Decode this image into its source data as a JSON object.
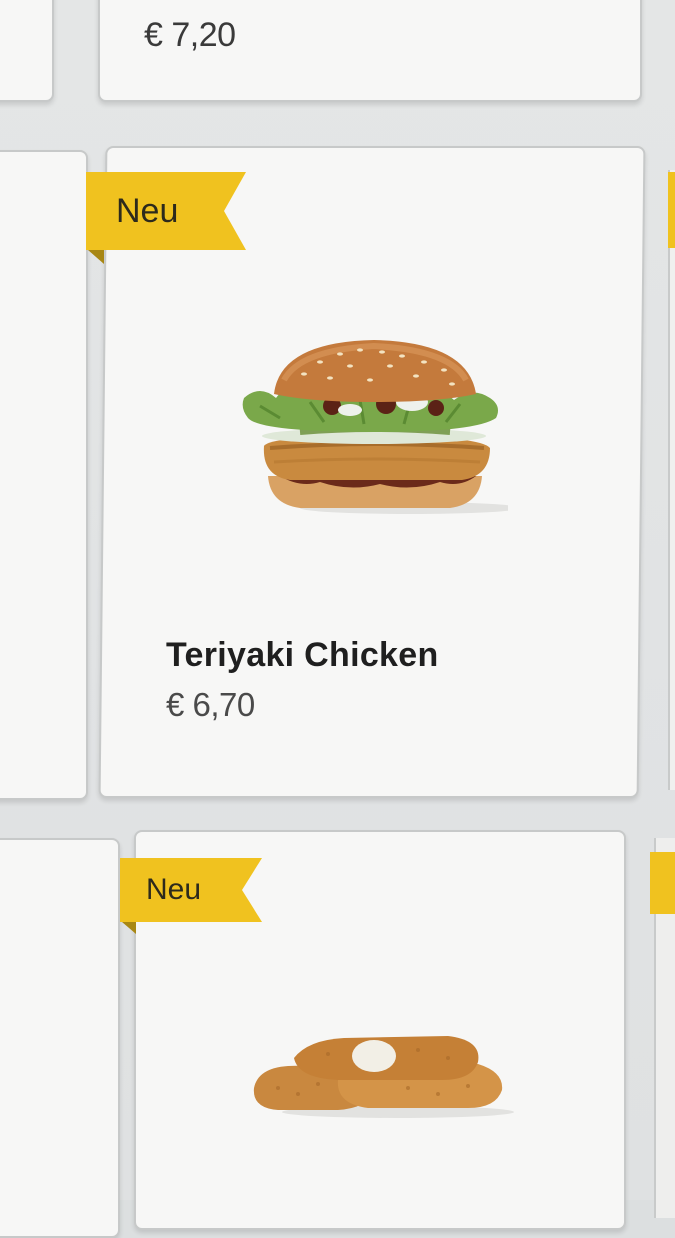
{
  "menu": {
    "top_card": {
      "price": "€ 7,20"
    },
    "featured_card": {
      "badge": "Neu",
      "name": "Teriyaki Chicken",
      "price": "€ 6,70",
      "image_icon": "burger-icon"
    },
    "bottom_card": {
      "badge": "Neu",
      "image_icon": "chicken-strips-icon"
    }
  },
  "colors": {
    "badge_yellow": "#f0c21f",
    "card_background": "#f7f7f6",
    "screen_background": "#e1e3e4"
  }
}
